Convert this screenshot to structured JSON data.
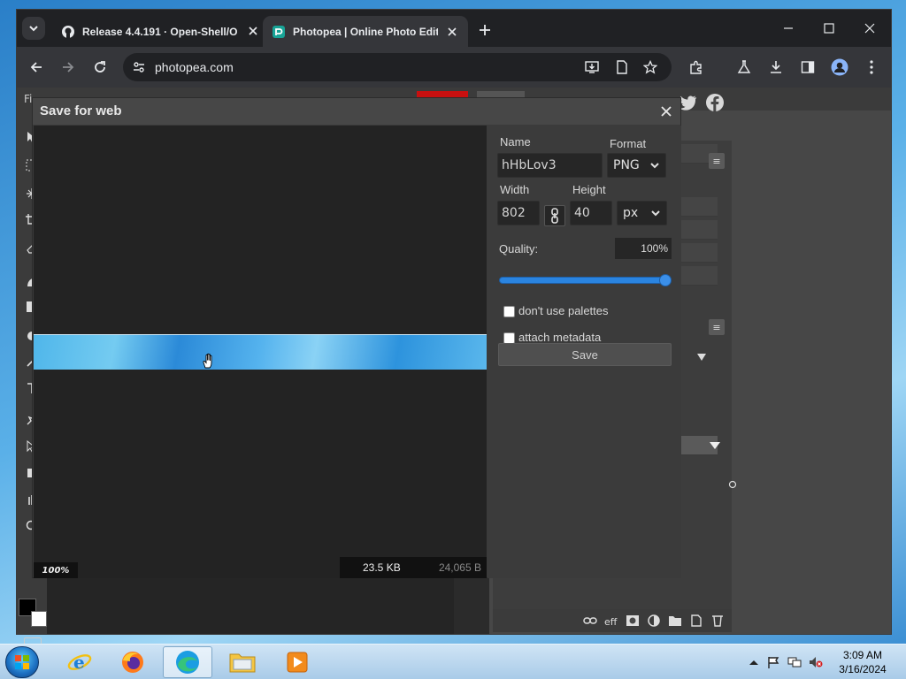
{
  "browser": {
    "tabs": [
      {
        "title": "Release 4.4.191 · Open-Shell/O",
        "active": false,
        "icon": "github-icon"
      },
      {
        "title": "Photopea | Online Photo Editor",
        "active": true,
        "icon": "photopea-icon"
      }
    ],
    "address": "photopea.com"
  },
  "photopea": {
    "menu_hint": "Fi",
    "social": [
      "twitter-icon",
      "facebook-icon"
    ]
  },
  "dialog": {
    "title": "Save for web",
    "zoom": "100%",
    "file_size_kb": "23.5 KB",
    "file_size_bytes": "24,065 B",
    "settings": {
      "name_label": "Name",
      "name_value": "hHbLov3",
      "format_label": "Format",
      "format_value": "PNG",
      "width_label": "Width",
      "width_value": "802",
      "height_label": "Height",
      "height_value": "40",
      "unit_value": "px",
      "quality_label": "Quality:",
      "quality_value": "100%",
      "quality_level": 1.0,
      "palettes_label": "don't use palettes",
      "palettes_checked": false,
      "metadata_label": "attach metadata",
      "metadata_checked": false,
      "save_label": "Save"
    }
  },
  "taskbar": {
    "apps": [
      "internet-explorer-icon",
      "firefox-icon",
      "edge-icon",
      "file-explorer-icon",
      "media-player-icon"
    ],
    "time": "3:09 AM",
    "date": "3/16/2024"
  },
  "colors": {
    "accent": "#2a84e0",
    "photopea_red": "#c81010"
  }
}
